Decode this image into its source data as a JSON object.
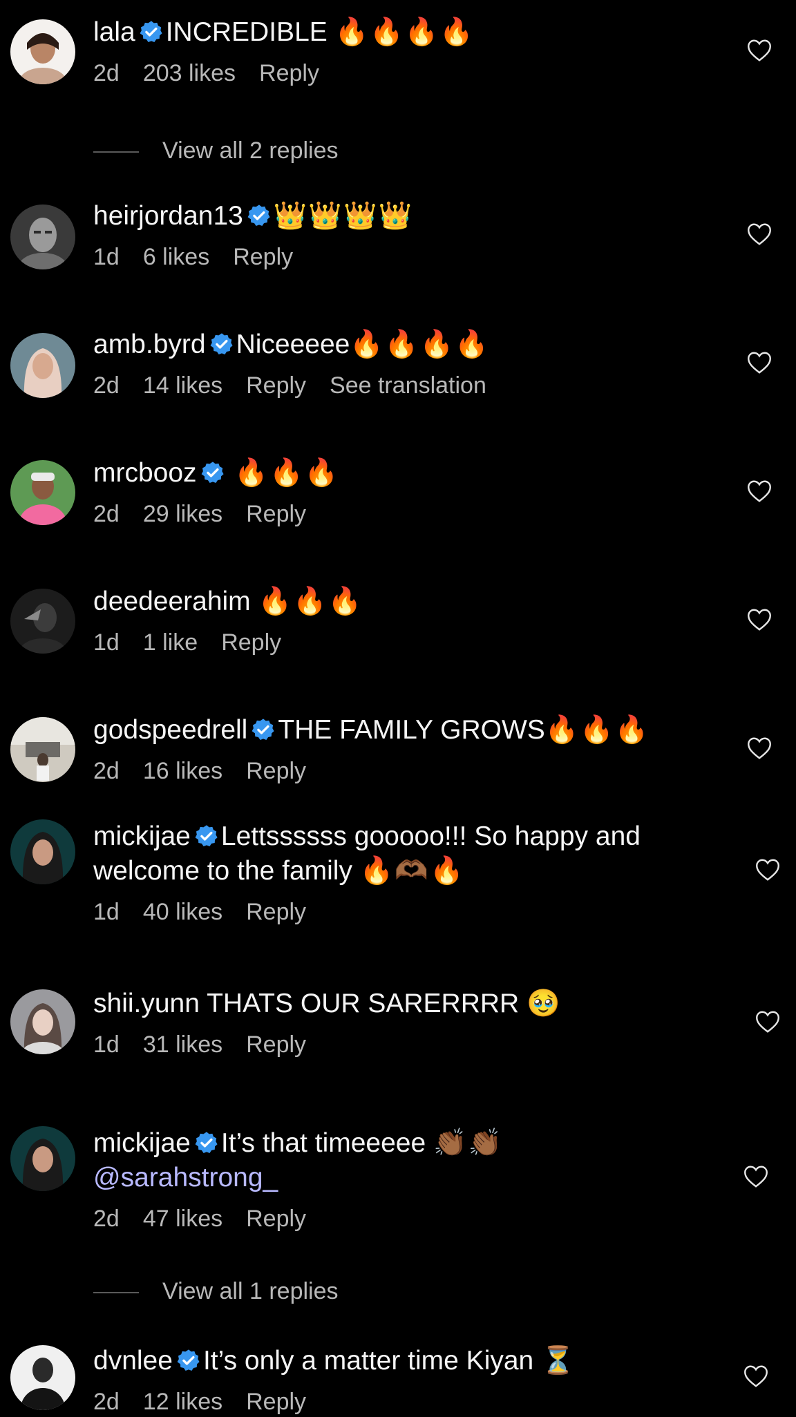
{
  "comments": [
    {
      "username": "lala",
      "verified": true,
      "text": "INCREDIBLE",
      "emoji": "🔥🔥🔥🔥",
      "time": "2d",
      "likes": "203 likes",
      "reply": "Reply"
    },
    {
      "username": "heirjordan13",
      "verified": true,
      "text": "",
      "emoji": "👑👑👑👑",
      "time": "1d",
      "likes": "6 likes",
      "reply": "Reply"
    },
    {
      "username": "amb.byrd",
      "verified": true,
      "text": "Niceeeee",
      "emoji": "🔥🔥🔥🔥",
      "time": "2d",
      "likes": "14 likes",
      "reply": "Reply",
      "extra": "See translation"
    },
    {
      "username": "mrcbooz",
      "verified": true,
      "text": "",
      "emoji": "🔥🔥🔥",
      "time": "2d",
      "likes": "29 likes",
      "reply": "Reply"
    },
    {
      "username": "deedeerahim",
      "verified": false,
      "text": "",
      "emoji": "🔥🔥🔥",
      "time": "1d",
      "likes": "1 like",
      "reply": "Reply"
    },
    {
      "username": "godspeedrell",
      "verified": true,
      "text": "THE FAMILY GROWS",
      "emoji": "🔥🔥🔥",
      "time": "2d",
      "likes": "16 likes",
      "reply": "Reply"
    },
    {
      "username": "mickijae",
      "verified": true,
      "text": "Lettssssss gooooo!!! So happy and welcome to the family",
      "emoji": "🔥🫶🏾🔥",
      "time": "1d",
      "likes": "40 likes",
      "reply": "Reply"
    },
    {
      "username": "shii.yunn",
      "verified": false,
      "text": "THATS OUR SARERRRR",
      "emoji": "🥹",
      "time": "1d",
      "likes": "31 likes",
      "reply": "Reply"
    },
    {
      "username": "mickijae",
      "verified": true,
      "text": "It’s that timeeeee",
      "emoji": "👏🏾👏🏾",
      "mention": "@sarahstrong_",
      "time": "2d",
      "likes": "47 likes",
      "reply": "Reply"
    },
    {
      "username": "dvnlee",
      "verified": true,
      "text": "It’s only a matter time Kiyan",
      "emoji": "⏳",
      "time": "2d",
      "likes": "12 likes",
      "reply": "Reply"
    }
  ],
  "view_replies": [
    "View all 2 replies",
    "View all 1 replies"
  ],
  "colors": {
    "background": "#000000",
    "text": "#f5f5f5",
    "meta": "#b8b8b8",
    "verified": "#3897f0",
    "mention": "#b8b9ff"
  }
}
